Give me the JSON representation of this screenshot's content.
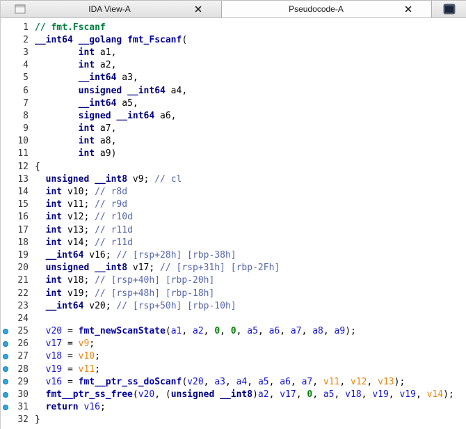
{
  "tab_bar": {
    "tabs": [
      {
        "label": "IDA View-A",
        "icon": "window-icon",
        "active": false,
        "closable": true
      },
      {
        "label": "Pseudocode-A",
        "icon": null,
        "active": true,
        "closable": true
      },
      {
        "label": "",
        "icon": "pseudocode-window-icon",
        "active": false,
        "closable": false,
        "partial": true
      }
    ]
  },
  "editor": {
    "language": "c-pseudocode",
    "function": "fmt_Fscanf",
    "lines": [
      {
        "n": 1,
        "dot": false,
        "segs": [
          [
            "// fmt.Fscanf",
            "g"
          ]
        ]
      },
      {
        "n": 2,
        "dot": false,
        "segs": [
          [
            "__int64 __golang ",
            "k"
          ],
          [
            "fmt_Fscanf",
            "f"
          ],
          [
            "(",
            "p"
          ]
        ]
      },
      {
        "n": 3,
        "dot": false,
        "segs": [
          [
            "        ",
            "p"
          ],
          [
            "int",
            "k"
          ],
          [
            " a1,",
            "p"
          ]
        ]
      },
      {
        "n": 4,
        "dot": false,
        "segs": [
          [
            "        ",
            "p"
          ],
          [
            "int",
            "k"
          ],
          [
            " a2,",
            "p"
          ]
        ]
      },
      {
        "n": 5,
        "dot": false,
        "segs": [
          [
            "        ",
            "p"
          ],
          [
            "__int64",
            "k"
          ],
          [
            " a3,",
            "p"
          ]
        ]
      },
      {
        "n": 6,
        "dot": false,
        "segs": [
          [
            "        ",
            "p"
          ],
          [
            "unsigned __int64",
            "k"
          ],
          [
            " a4,",
            "p"
          ]
        ]
      },
      {
        "n": 7,
        "dot": false,
        "segs": [
          [
            "        ",
            "p"
          ],
          [
            "__int64",
            "k"
          ],
          [
            " a5,",
            "p"
          ]
        ]
      },
      {
        "n": 8,
        "dot": false,
        "segs": [
          [
            "        ",
            "p"
          ],
          [
            "signed __int64",
            "k"
          ],
          [
            " a6,",
            "p"
          ]
        ]
      },
      {
        "n": 9,
        "dot": false,
        "segs": [
          [
            "        ",
            "p"
          ],
          [
            "int",
            "k"
          ],
          [
            " a7,",
            "p"
          ]
        ]
      },
      {
        "n": 10,
        "dot": false,
        "segs": [
          [
            "        ",
            "p"
          ],
          [
            "int",
            "k"
          ],
          [
            " a8,",
            "p"
          ]
        ]
      },
      {
        "n": 11,
        "dot": false,
        "segs": [
          [
            "        ",
            "p"
          ],
          [
            "int",
            "k"
          ],
          [
            " a9)",
            "p"
          ]
        ]
      },
      {
        "n": 12,
        "dot": false,
        "segs": [
          [
            "{",
            "p"
          ]
        ]
      },
      {
        "n": 13,
        "dot": false,
        "segs": [
          [
            "  ",
            "p"
          ],
          [
            "unsigned __int8",
            "k"
          ],
          [
            " v9; ",
            "p"
          ],
          [
            "// cl",
            "c"
          ]
        ]
      },
      {
        "n": 14,
        "dot": false,
        "segs": [
          [
            "  ",
            "p"
          ],
          [
            "int",
            "k"
          ],
          [
            " v10; ",
            "p"
          ],
          [
            "// r8d",
            "c"
          ]
        ]
      },
      {
        "n": 15,
        "dot": false,
        "segs": [
          [
            "  ",
            "p"
          ],
          [
            "int",
            "k"
          ],
          [
            " v11; ",
            "p"
          ],
          [
            "// r9d",
            "c"
          ]
        ]
      },
      {
        "n": 16,
        "dot": false,
        "segs": [
          [
            "  ",
            "p"
          ],
          [
            "int",
            "k"
          ],
          [
            " v12; ",
            "p"
          ],
          [
            "// r10d",
            "c"
          ]
        ]
      },
      {
        "n": 17,
        "dot": false,
        "segs": [
          [
            "  ",
            "p"
          ],
          [
            "int",
            "k"
          ],
          [
            " v13; ",
            "p"
          ],
          [
            "// r11d",
            "c"
          ]
        ]
      },
      {
        "n": 18,
        "dot": false,
        "segs": [
          [
            "  ",
            "p"
          ],
          [
            "int",
            "k"
          ],
          [
            " v14; ",
            "p"
          ],
          [
            "// r11d",
            "c"
          ]
        ]
      },
      {
        "n": 19,
        "dot": false,
        "segs": [
          [
            "  ",
            "p"
          ],
          [
            "__int64",
            "k"
          ],
          [
            " v16; ",
            "p"
          ],
          [
            "// [rsp+28h] [rbp-38h]",
            "c"
          ]
        ]
      },
      {
        "n": 20,
        "dot": false,
        "segs": [
          [
            "  ",
            "p"
          ],
          [
            "unsigned __int8",
            "k"
          ],
          [
            " v17; ",
            "p"
          ],
          [
            "// [rsp+31h] [rbp-2Fh]",
            "c"
          ]
        ]
      },
      {
        "n": 21,
        "dot": false,
        "segs": [
          [
            "  ",
            "p"
          ],
          [
            "int",
            "k"
          ],
          [
            " v18; ",
            "p"
          ],
          [
            "// [rsp+40h] [rbp-20h]",
            "c"
          ]
        ]
      },
      {
        "n": 22,
        "dot": false,
        "segs": [
          [
            "  ",
            "p"
          ],
          [
            "int",
            "k"
          ],
          [
            " v19; ",
            "p"
          ],
          [
            "// [rsp+48h] [rbp-18h]",
            "c"
          ]
        ]
      },
      {
        "n": 23,
        "dot": false,
        "segs": [
          [
            "  ",
            "p"
          ],
          [
            "__int64",
            "k"
          ],
          [
            " v20; ",
            "p"
          ],
          [
            "// [rsp+50h] [rbp-10h]",
            "c"
          ]
        ]
      },
      {
        "n": 24,
        "dot": false,
        "segs": []
      },
      {
        "n": 25,
        "dot": true,
        "segs": [
          [
            "  ",
            "p"
          ],
          [
            "v20",
            "v"
          ],
          [
            " = ",
            "p"
          ],
          [
            "fmt_newScanState",
            "f"
          ],
          [
            "(",
            "p"
          ],
          [
            "a1",
            "v"
          ],
          [
            ", ",
            "p"
          ],
          [
            "a2",
            "v"
          ],
          [
            ", ",
            "p"
          ],
          [
            "0",
            "n"
          ],
          [
            ", ",
            "p"
          ],
          [
            "0",
            "n"
          ],
          [
            ", ",
            "p"
          ],
          [
            "a5",
            "v"
          ],
          [
            ", ",
            "p"
          ],
          [
            "a6",
            "v"
          ],
          [
            ", ",
            "p"
          ],
          [
            "a7",
            "v"
          ],
          [
            ", ",
            "p"
          ],
          [
            "a8",
            "v"
          ],
          [
            ", ",
            "p"
          ],
          [
            "a9",
            "v"
          ],
          [
            ");",
            "p"
          ]
        ]
      },
      {
        "n": 26,
        "dot": true,
        "segs": [
          [
            "  ",
            "p"
          ],
          [
            "v17",
            "v"
          ],
          [
            " = ",
            "p"
          ],
          [
            "v9",
            "o"
          ],
          [
            ";",
            "p"
          ]
        ]
      },
      {
        "n": 27,
        "dot": true,
        "segs": [
          [
            "  ",
            "p"
          ],
          [
            "v18",
            "v"
          ],
          [
            " = ",
            "p"
          ],
          [
            "v10",
            "o"
          ],
          [
            ";",
            "p"
          ]
        ]
      },
      {
        "n": 28,
        "dot": true,
        "segs": [
          [
            "  ",
            "p"
          ],
          [
            "v19",
            "v"
          ],
          [
            " = ",
            "p"
          ],
          [
            "v11",
            "o"
          ],
          [
            ";",
            "p"
          ]
        ]
      },
      {
        "n": 29,
        "dot": true,
        "segs": [
          [
            "  ",
            "p"
          ],
          [
            "v16",
            "v"
          ],
          [
            " = ",
            "p"
          ],
          [
            "fmt__ptr_ss_doScanf",
            "f"
          ],
          [
            "(",
            "p"
          ],
          [
            "v20",
            "v"
          ],
          [
            ", ",
            "p"
          ],
          [
            "a3",
            "v"
          ],
          [
            ", ",
            "p"
          ],
          [
            "a4",
            "v"
          ],
          [
            ", ",
            "p"
          ],
          [
            "a5",
            "v"
          ],
          [
            ", ",
            "p"
          ],
          [
            "a6",
            "v"
          ],
          [
            ", ",
            "p"
          ],
          [
            "a7",
            "v"
          ],
          [
            ", ",
            "p"
          ],
          [
            "v11",
            "o"
          ],
          [
            ", ",
            "p"
          ],
          [
            "v12",
            "o"
          ],
          [
            ", ",
            "p"
          ],
          [
            "v13",
            "o"
          ],
          [
            ");",
            "p"
          ]
        ]
      },
      {
        "n": 30,
        "dot": true,
        "segs": [
          [
            "  ",
            "p"
          ],
          [
            "fmt__ptr_ss_free",
            "f"
          ],
          [
            "(",
            "p"
          ],
          [
            "v20",
            "v"
          ],
          [
            ", (",
            "p"
          ],
          [
            "unsigned __int8",
            "k"
          ],
          [
            ")",
            "p"
          ],
          [
            "a2",
            "v"
          ],
          [
            ", ",
            "p"
          ],
          [
            "v17",
            "v"
          ],
          [
            ", ",
            "p"
          ],
          [
            "0",
            "n"
          ],
          [
            ", ",
            "p"
          ],
          [
            "a5",
            "v"
          ],
          [
            ", ",
            "p"
          ],
          [
            "v18",
            "v"
          ],
          [
            ", ",
            "p"
          ],
          [
            "v19",
            "v"
          ],
          [
            ", ",
            "p"
          ],
          [
            "v19",
            "v"
          ],
          [
            ", ",
            "p"
          ],
          [
            "v14",
            "o"
          ],
          [
            ");",
            "p"
          ]
        ]
      },
      {
        "n": 31,
        "dot": true,
        "segs": [
          [
            "  ",
            "p"
          ],
          [
            "return",
            "k"
          ],
          [
            " ",
            "p"
          ],
          [
            "v16",
            "v"
          ],
          [
            ";",
            "p"
          ]
        ]
      },
      {
        "n": 32,
        "dot": false,
        "segs": [
          [
            "}",
            "p"
          ]
        ]
      }
    ]
  },
  "colors": {
    "plain": "#000000",
    "kw": "#000080",
    "fn": "#0000A0",
    "lvar": "#1414D2",
    "undef": "#E8850F",
    "num": "#008000",
    "cmt": "#5566AA",
    "gcmt": "#008040",
    "lnum": "#383838",
    "dotfill": "#2FA8DF",
    "dotedge": "#1779AD"
  }
}
